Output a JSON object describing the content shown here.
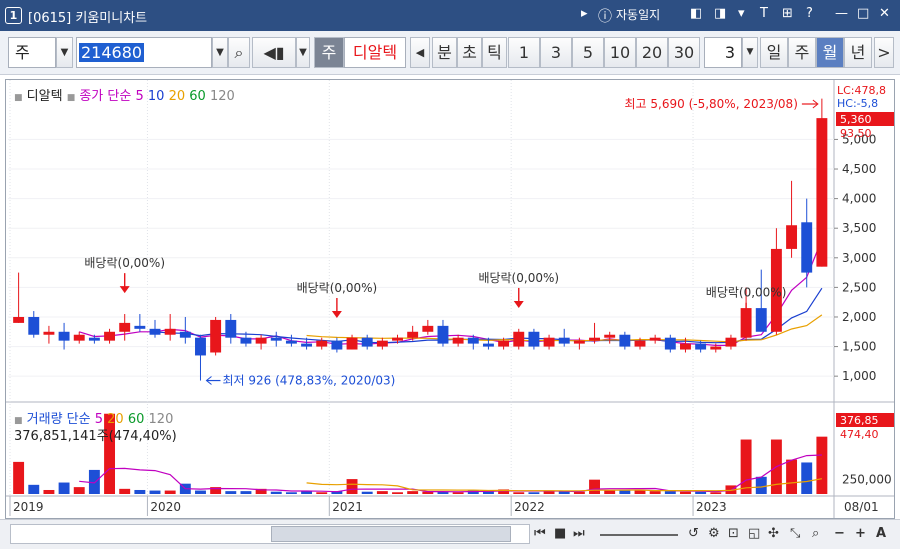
{
  "window": {
    "number": "1",
    "title": "[0615] 키움미니차트",
    "auto_log": "자동일지",
    "buttons": [
      "▸",
      "◧",
      "◨",
      "▾",
      "T",
      "⊞",
      "?",
      "—",
      "□",
      "✕"
    ]
  },
  "toolbar": {
    "market": "주",
    "code": "214680",
    "type_label": "주",
    "stock_name": "디알텍",
    "periods": [
      "분",
      "초",
      "틱"
    ],
    "intervals": [
      "1",
      "3",
      "5",
      "10",
      "20",
      "30"
    ],
    "interval_select": "3",
    "cycles": [
      "일",
      "주",
      "월",
      "년"
    ],
    "active_cycle": "월",
    "next": ">"
  },
  "legend": {
    "stock": "디알텍",
    "price_label": "종가 단순",
    "ma": [
      "5",
      "10",
      "20",
      "60",
      "120"
    ],
    "ma_colors": [
      "#c000c0",
      "#1a3fd0",
      "#e8a000",
      "#0a9a2a",
      "#888888"
    ],
    "volume_label": "거래량 단순",
    "volume_ma": [
      "5",
      "20",
      "60",
      "120"
    ],
    "volume_value": "376,851,141주(474,40%)"
  },
  "annotations": {
    "high": "최고 5,690 (-5,80%, 2023/08)",
    "low": "최저 926 (478,83%, 2020/03)",
    "dividends": [
      "배당락(0,00%)",
      "배당락(0,00%)",
      "배당락(0,00%)",
      "배당락(0,00%)"
    ]
  },
  "price_axis": {
    "ticks": [
      "5,000",
      "4,500",
      "4,000",
      "3,500",
      "3,000",
      "2,500",
      "2,000",
      "1,500",
      "1,000"
    ],
    "lc": "LC:478,8",
    "hc": "HC:-5,8",
    "current": "5,360",
    "pct": "93,50"
  },
  "volume_axis": {
    "ticks": [
      "250,000"
    ],
    "current": "376,85",
    "pct": "474,40"
  },
  "x_axis": {
    "labels": [
      "2019",
      "2020",
      "2021",
      "2022",
      "2023"
    ],
    "date": "08/01"
  },
  "colors": {
    "up": "#e8161b",
    "down": "#1d4fd6",
    "title_bg": "#2d4f83"
  },
  "chart_data": {
    "type": "candlestick",
    "candles": [
      [
        1900,
        2750,
        1900,
        2000
      ],
      [
        2000,
        2100,
        1650,
        1700
      ],
      [
        1700,
        1850,
        1550,
        1750
      ],
      [
        1750,
        1900,
        1450,
        1600
      ],
      [
        1600,
        1750,
        1550,
        1700
      ],
      [
        1650,
        1700,
        1550,
        1600
      ],
      [
        1600,
        1800,
        1550,
        1750
      ],
      [
        1750,
        2050,
        1600,
        1900
      ],
      [
        1850,
        2050,
        1750,
        1800
      ],
      [
        1800,
        1950,
        1650,
        1700
      ],
      [
        1700,
        2050,
        1600,
        1800
      ],
      [
        1750,
        2000,
        1550,
        1650
      ],
      [
        1650,
        1700,
        926,
        1350
      ],
      [
        1400,
        2000,
        1350,
        1950
      ],
      [
        1950,
        2050,
        1550,
        1650
      ],
      [
        1650,
        1750,
        1500,
        1550
      ],
      [
        1550,
        1700,
        1450,
        1650
      ],
      [
        1650,
        1750,
        1500,
        1600
      ],
      [
        1600,
        1700,
        1500,
        1550
      ],
      [
        1550,
        1650,
        1450,
        1500
      ],
      [
        1500,
        1650,
        1450,
        1600
      ],
      [
        1600,
        1650,
        1400,
        1450
      ],
      [
        1450,
        1700,
        1450,
        1650
      ],
      [
        1650,
        1700,
        1450,
        1500
      ],
      [
        1500,
        1650,
        1450,
        1600
      ],
      [
        1600,
        1700,
        1550,
        1650
      ],
      [
        1650,
        1850,
        1600,
        1750
      ],
      [
        1750,
        1950,
        1700,
        1850
      ],
      [
        1850,
        1950,
        1500,
        1550
      ],
      [
        1550,
        1700,
        1500,
        1650
      ],
      [
        1650,
        1700,
        1450,
        1550
      ],
      [
        1550,
        1650,
        1450,
        1500
      ],
      [
        1500,
        1650,
        1450,
        1600
      ],
      [
        1500,
        1800,
        1450,
        1750
      ],
      [
        1750,
        1800,
        1450,
        1500
      ],
      [
        1500,
        1700,
        1450,
        1650
      ],
      [
        1650,
        1800,
        1500,
        1550
      ],
      [
        1550,
        1650,
        1450,
        1600
      ],
      [
        1600,
        1900,
        1550,
        1650
      ],
      [
        1650,
        1750,
        1550,
        1700
      ],
      [
        1700,
        1750,
        1450,
        1500
      ],
      [
        1500,
        1650,
        1450,
        1600
      ],
      [
        1600,
        1700,
        1550,
        1650
      ],
      [
        1650,
        1700,
        1400,
        1450
      ],
      [
        1450,
        1650,
        1400,
        1550
      ],
      [
        1550,
        1600,
        1400,
        1450
      ],
      [
        1450,
        1550,
        1400,
        1500
      ],
      [
        1500,
        1700,
        1450,
        1650
      ],
      [
        1650,
        2500,
        1600,
        2150
      ],
      [
        2150,
        2800,
        2000,
        1750
      ],
      [
        1750,
        3500,
        1700,
        3150
      ],
      [
        3150,
        4300,
        3000,
        3550
      ],
      [
        3600,
        4000,
        2500,
        2750
      ],
      [
        2850,
        5690,
        2850,
        5360
      ]
    ],
    "volume": [
      56000,
      16000,
      7000,
      20000,
      12000,
      42000,
      140000,
      9000,
      7000,
      6000,
      6000,
      18000,
      6000,
      12000,
      5000,
      5000,
      9000,
      4000,
      3000,
      5000,
      3000,
      5000,
      26000,
      4000,
      5000,
      3000,
      5000,
      4000,
      4000,
      3000,
      6000,
      6000,
      8000,
      3000,
      3000,
      6000,
      5000,
      4000,
      25000,
      6000,
      6000,
      6000,
      5000,
      5000,
      4000,
      4000,
      3000,
      15000,
      95000,
      30000,
      95000,
      60000,
      55000,
      100000
    ],
    "ylim": [
      800,
      5700
    ],
    "vol_max": 150000
  }
}
